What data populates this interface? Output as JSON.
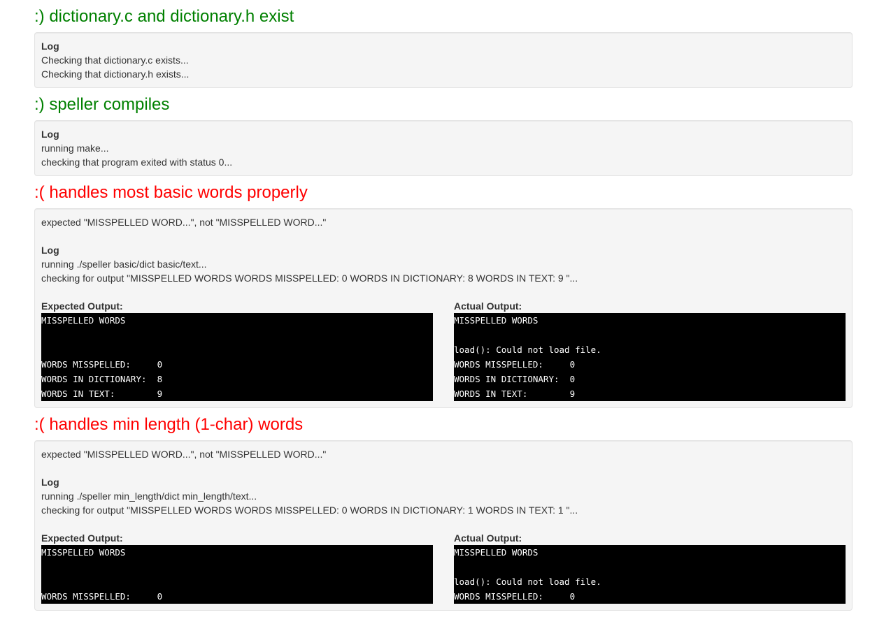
{
  "checks": [
    {
      "status": "pass",
      "title": ":) dictionary.c and dictionary.h exist",
      "log_label": "Log",
      "log": [
        "Checking that dictionary.c exists...",
        "Checking that dictionary.h exists..."
      ]
    },
    {
      "status": "pass",
      "title": ":) speller compiles",
      "log_label": "Log",
      "log": [
        "running make...",
        "checking that program exited with status 0..."
      ]
    },
    {
      "status": "fail",
      "title": ":( handles most basic words properly",
      "rationale": "expected \"MISSPELLED WORD...\", not \"MISSPELLED WORD...\"",
      "log_label": "Log",
      "log": [
        "running ./speller basic/dict basic/text...",
        "checking for output \"MISSPELLED WORDS WORDS MISSPELLED: 0 WORDS IN DICTIONARY: 8 WORDS IN TEXT: 9 \"..."
      ],
      "expected_label": "Expected Output:",
      "expected": [
        "MISSPELLED WORDS",
        "",
        "",
        "WORDS MISSPELLED:     0",
        "WORDS IN DICTIONARY:  8",
        "WORDS IN TEXT:        9"
      ],
      "actual_label": "Actual Output:",
      "actual": [
        "MISSPELLED WORDS",
        "",
        "load(): Could not load file.",
        "WORDS MISSPELLED:     0",
        "WORDS IN DICTIONARY:  0",
        "WORDS IN TEXT:        9"
      ]
    },
    {
      "status": "fail",
      "title": ":( handles min length (1-char) words",
      "rationale": "expected \"MISSPELLED WORD...\", not \"MISSPELLED WORD...\"",
      "log_label": "Log",
      "log": [
        "running ./speller min_length/dict min_length/text...",
        "checking for output \"MISSPELLED WORDS WORDS MISSPELLED: 0 WORDS IN DICTIONARY: 1 WORDS IN TEXT: 1 \"..."
      ],
      "expected_label": "Expected Output:",
      "expected": [
        "MISSPELLED WORDS",
        "",
        "",
        "WORDS MISSPELLED:     0"
      ],
      "actual_label": "Actual Output:",
      "actual": [
        "MISSPELLED WORDS",
        "",
        "load(): Could not load file.",
        "WORDS MISSPELLED:     0"
      ]
    }
  ]
}
